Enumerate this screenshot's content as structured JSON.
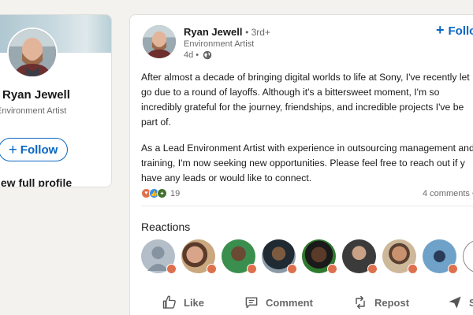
{
  "profile": {
    "name": "Ryan Jewell",
    "headline": "Environment Artist",
    "follow_label": "Follow",
    "view_profile": "iew full profile"
  },
  "post": {
    "author": {
      "name": "Ryan Jewell",
      "degree": "• 3rd+",
      "headline": "Environment Artist",
      "time": "4d •"
    },
    "follow_label": "Follo",
    "body": [
      "After almost a decade of bringing digital worlds to life at Sony, I've recently let go due to a round of layoffs. Although it's a bittersweet moment, I'm so incredibly grateful for the journey, friendships, and incredible projects I've be part of.",
      "As a Lead Environment Artist with experience in outsourcing management and training, I'm now seeking new opportunities. Please feel free to reach out if y have any leads or would like to connect."
    ],
    "reaction_count": "19",
    "comments": "4 comments •",
    "reactions_title": "Reactions",
    "reactors": [
      {
        "name": "reactor-1",
        "bg": "#b4bec8"
      },
      {
        "name": "reactor-2",
        "bg": "#caa77e"
      },
      {
        "name": "reactor-3",
        "bg": "#3a8f4e"
      },
      {
        "name": "reactor-4",
        "bg": "#8a9aa6"
      },
      {
        "name": "reactor-5",
        "bg": "#2f7a2f"
      },
      {
        "name": "reactor-6",
        "bg": "#3b3b3b"
      },
      {
        "name": "reactor-7",
        "bg": "#cdb89a"
      },
      {
        "name": "reactor-8",
        "bg": "#6fa2c9"
      }
    ],
    "more": "+"
  },
  "actions": {
    "like": "Like",
    "comment": "Comment",
    "repost": "Repost",
    "send": "S"
  },
  "colors": {
    "brand": "#0a66c2",
    "background": "#f4f2ee",
    "love_badge": "#df704d"
  }
}
